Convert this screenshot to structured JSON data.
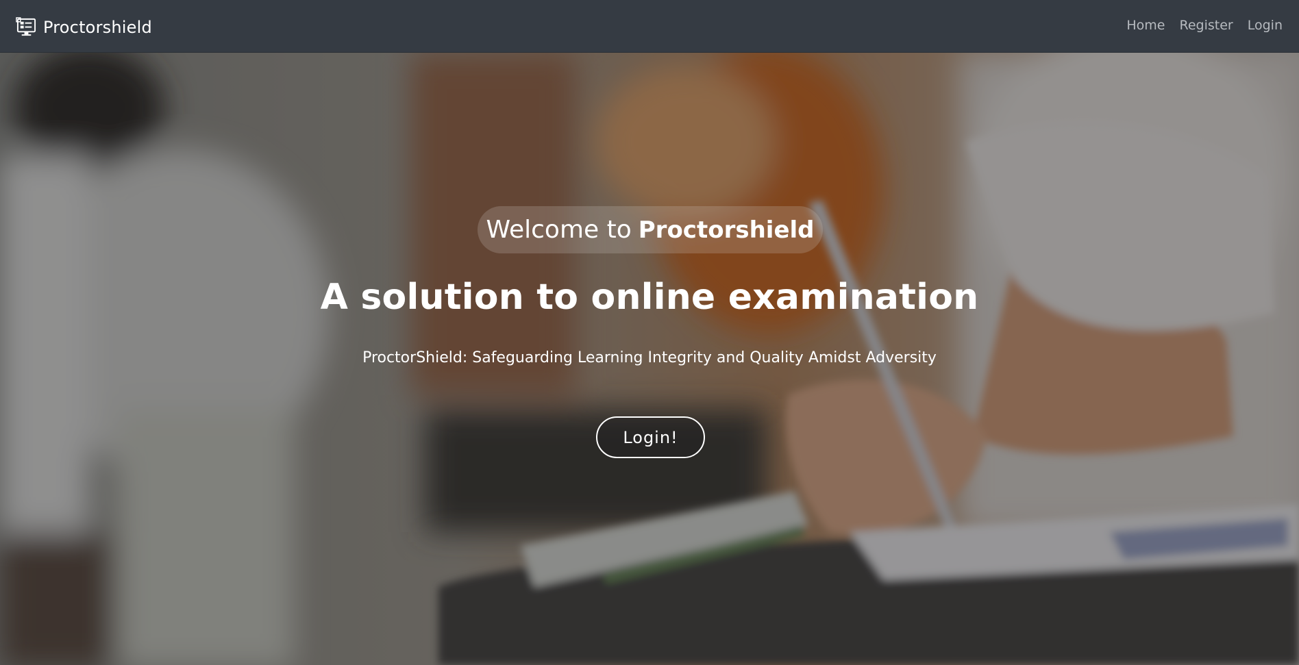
{
  "navbar": {
    "brand_name": "Proctorshield",
    "brand_icon": "computer-monitor-icon",
    "links": [
      {
        "label": "Home"
      },
      {
        "label": "Register"
      },
      {
        "label": "Login"
      }
    ]
  },
  "hero": {
    "welcome_prefix": "Welcome to",
    "welcome_brand": "Proctorshield",
    "title": "A solution to online examination",
    "subtitle": "ProctorShield: Safeguarding Learning Integrity and Quality Amidst Adversity",
    "cta_label": "Login!"
  },
  "colors": {
    "navbar_bg": "#353b43",
    "nav_link": "#b7bbc0",
    "hero_text": "#ffffff"
  }
}
